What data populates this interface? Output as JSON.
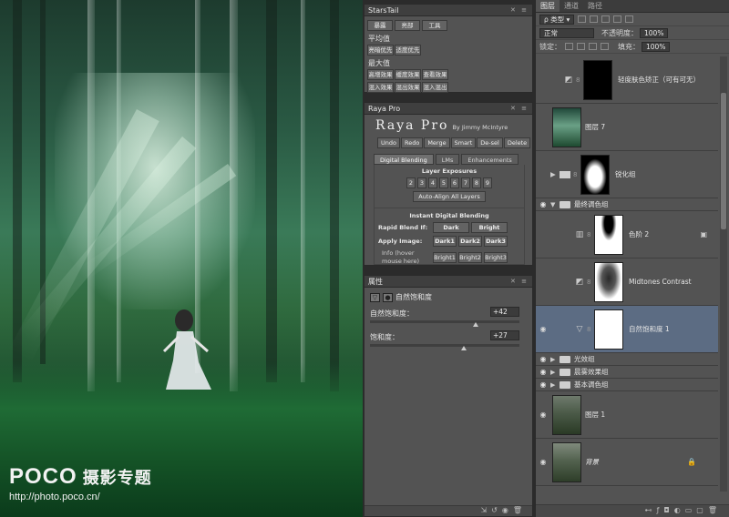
{
  "watermark": {
    "logo": "POCO",
    "subtitle": "摄影专题",
    "url": "http://photo.poco.cn/"
  },
  "stars": {
    "title": "StarsTail",
    "tabs": [
      "暴露",
      "亮部",
      "工具"
    ],
    "sec1": "平均值",
    "row1": [
      "亮暗优先",
      "适度优先"
    ],
    "sec2": "最大值",
    "row2": [
      "高增效果",
      "缓度效果",
      "查看效果"
    ],
    "row3": [
      "混入效果",
      "混出效果",
      "混入混出"
    ]
  },
  "raya": {
    "title": "Raya Pro",
    "brand": "Raya Pro",
    "byline": "By Jimmy McIntyre",
    "tools": [
      "Undo",
      "Redo",
      "Merge",
      "Smart",
      "De-sel",
      "Delete"
    ],
    "tabs": [
      "Digital Blending",
      "LMs",
      "Enhancements"
    ],
    "layer_exposures": "Layer Exposures",
    "nums": [
      "2",
      "3",
      "4",
      "5",
      "6",
      "7",
      "8",
      "9"
    ],
    "auto_align": "Auto-Align All Layers",
    "instant": "Instant Digital Blending",
    "rapid_label": "Rapid Blend If:",
    "rapid": [
      "Dark",
      "Bright"
    ],
    "apply_label": "Apply Image:",
    "apply_dark": [
      "Dark1",
      "Dark2",
      "Dark3"
    ],
    "apply_bright": [
      "Bright1",
      "Bright2",
      "Bright3"
    ],
    "info": "Info (hover mouse here)"
  },
  "props": {
    "title": "属性",
    "adj_name": "自然饱和度",
    "vibrance_label": "自然饱和度：",
    "vibrance_value": "+42",
    "vibrance_level": 0.71,
    "saturation_label": "饱和度：",
    "saturation_value": "+27",
    "saturation_level": 0.63
  },
  "layers": {
    "tabs": [
      "图层",
      "通道",
      "路径"
    ],
    "filter": "类型",
    "blend_mode": "正常",
    "opacity_label": "不透明度：",
    "opacity": "100%",
    "lock_label": "锁定：",
    "fill_label": "填充：",
    "fill": "100%",
    "items": {
      "skin": "轻度肤色矫正（可有可无）",
      "layer7": "图层 7",
      "sharpen": "锐化组",
      "final_group": "最终调色组",
      "levels": "色阶 2",
      "midtones": "Midtones Contrast",
      "vibrance": "自然饱和度 1",
      "light_group": "光效组",
      "fog_group": "晨雾效果组",
      "base_group": "基本调色组",
      "layer1": "图层 1",
      "background": "背景"
    }
  }
}
